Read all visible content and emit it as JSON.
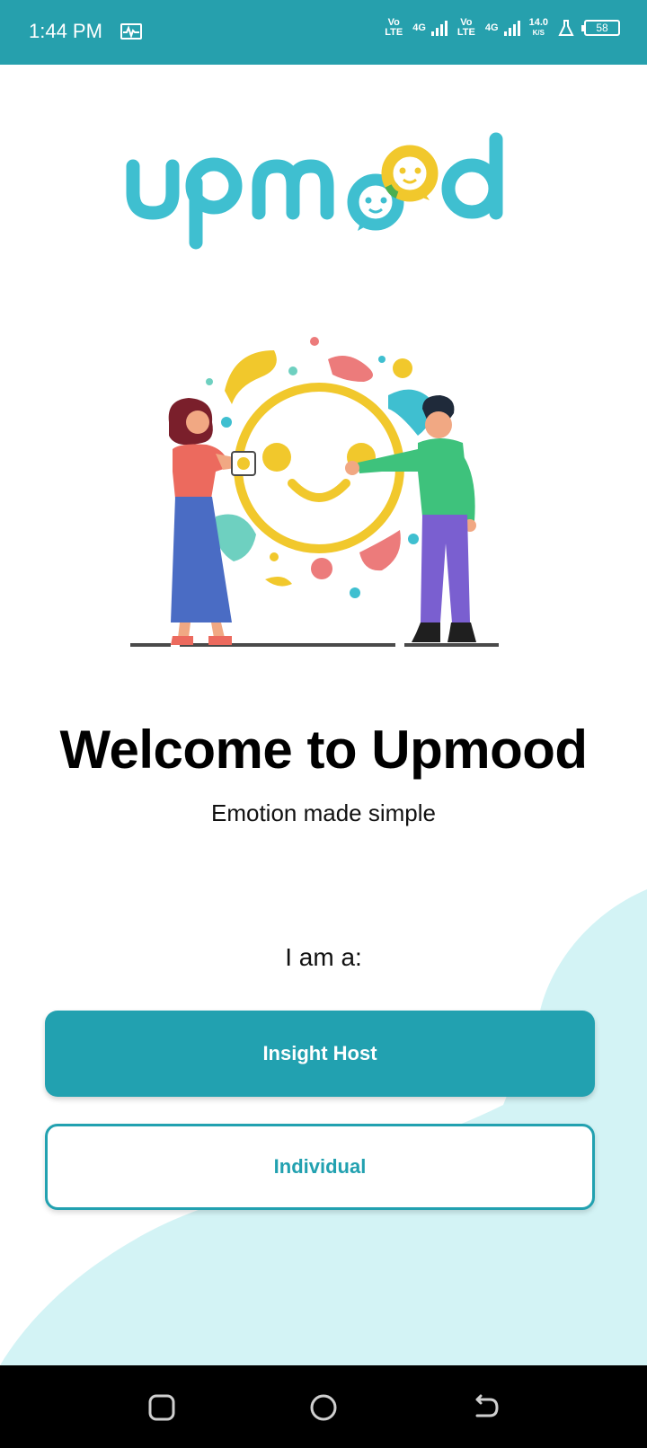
{
  "status_bar": {
    "time": "1:44 PM",
    "network1": "Vo LTE",
    "gen1": "4G",
    "network2": "Vo LTE",
    "gen2": "4G",
    "speed_value": "14.0",
    "speed_unit": "K/S",
    "battery": "58",
    "icons": [
      "activity-icon",
      "signal-icon",
      "flask-icon",
      "battery-icon"
    ]
  },
  "logo": {
    "text": "upmood"
  },
  "welcome": {
    "title": "Welcome to Upmood",
    "subtitle": "Emotion made simple"
  },
  "role": {
    "prompt": "I am a:",
    "primary_label": "Insight Host",
    "secondary_label": "Individual"
  },
  "colors": {
    "status_bar": "#26a0ad",
    "accent": "#22a1b0",
    "logo_teal": "#3fbfd0",
    "logo_yellow": "#f1c82c",
    "wave": "#d3f3f5"
  },
  "nav": {
    "icons": [
      "recents-icon",
      "home-icon",
      "back-icon"
    ]
  }
}
